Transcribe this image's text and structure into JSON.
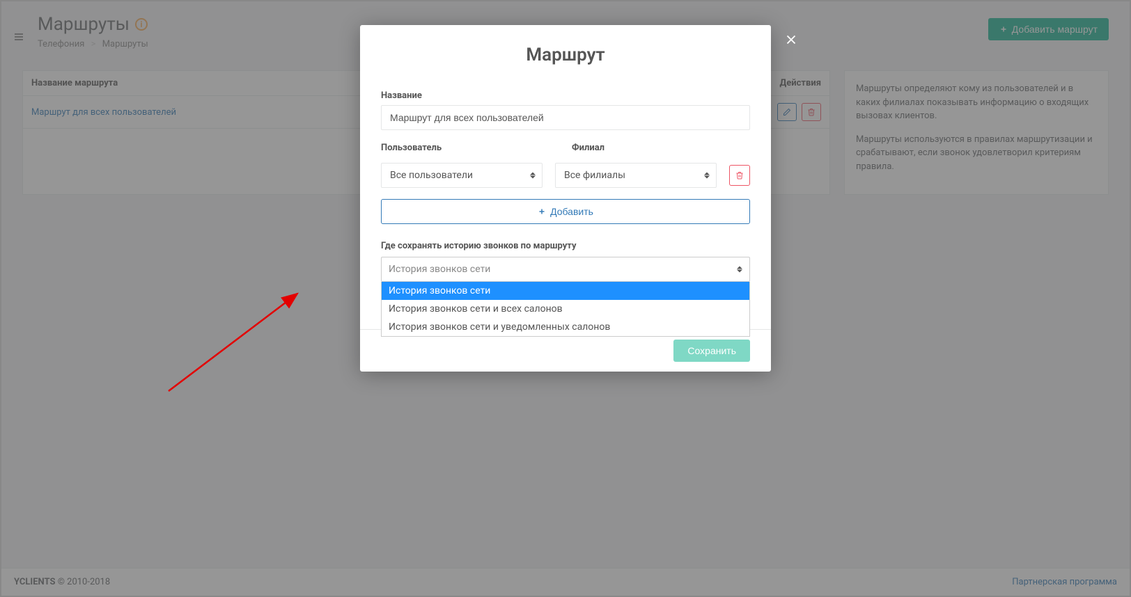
{
  "page": {
    "title": "Маршруты",
    "breadcrumb": {
      "section": "Телефония",
      "current": "Маршруты"
    },
    "add_route_label": "Добавить маршрут"
  },
  "table": {
    "col_name": "Название маршрута",
    "col_actions": "Действия",
    "rows": [
      {
        "name": "Маршрут для всех пользователей"
      }
    ]
  },
  "side": {
    "p1": "Маршруты определяют кому из пользователей и в каких филиалах показывать информацию о входящих вызовах клиентов.",
    "p2": "Маршруты используются в правилах маршрутизации и срабатывают, если звонок удовлетворил критериям правила."
  },
  "footer": {
    "brand": "YCLIENTS",
    "copyright": " © 2010-2018",
    "partner_link": "Партнерская программа"
  },
  "modal": {
    "title": "Маршрут",
    "name_label": "Название",
    "name_value": "Маршрут для всех пользователей",
    "user_label": "Пользователь",
    "branch_label": "Филиал",
    "user_value": "Все пользователи",
    "branch_value": "Все филиалы",
    "add_label": "Добавить",
    "history_label": "Где сохранять историю звонков по маршруту",
    "history_value": "История звонков сети",
    "history_options": [
      "История звонков сети",
      "История звонков сети и всех салонов",
      "История звонков сети и уведомленных салонов"
    ],
    "save_label": "Сохранить"
  }
}
